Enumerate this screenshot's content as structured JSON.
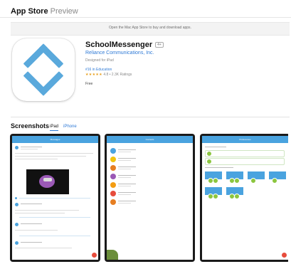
{
  "header": {
    "store": "App Store",
    "section": "Preview"
  },
  "banner": {
    "text": "Open the Mac App Store to buy and download apps."
  },
  "app": {
    "name": "SchoolMessenger",
    "age_rating": "4+",
    "developer": "Reliance Communications, Inc.",
    "designed_for": "Designed for iPad",
    "rank": "#16 in Education",
    "stars": "★★★★★",
    "rating_text": "4.8 • 2.3K Ratings",
    "price": "Free",
    "icon": "schoolmessenger-logo"
  },
  "screenshots": {
    "title": "Screenshots",
    "tabs": [
      "iPad",
      "iPhone"
    ],
    "selected_tab": "iPad",
    "items": [
      {
        "screen_title": "Messages"
      },
      {
        "screen_title": "Contacts"
      },
      {
        "screen_title": "Preferences"
      }
    ]
  },
  "colors": {
    "accent": "#2f7ad6",
    "app_bar": "#4aa3df",
    "star": "#e8a01e",
    "fab": "#e74c3c"
  }
}
